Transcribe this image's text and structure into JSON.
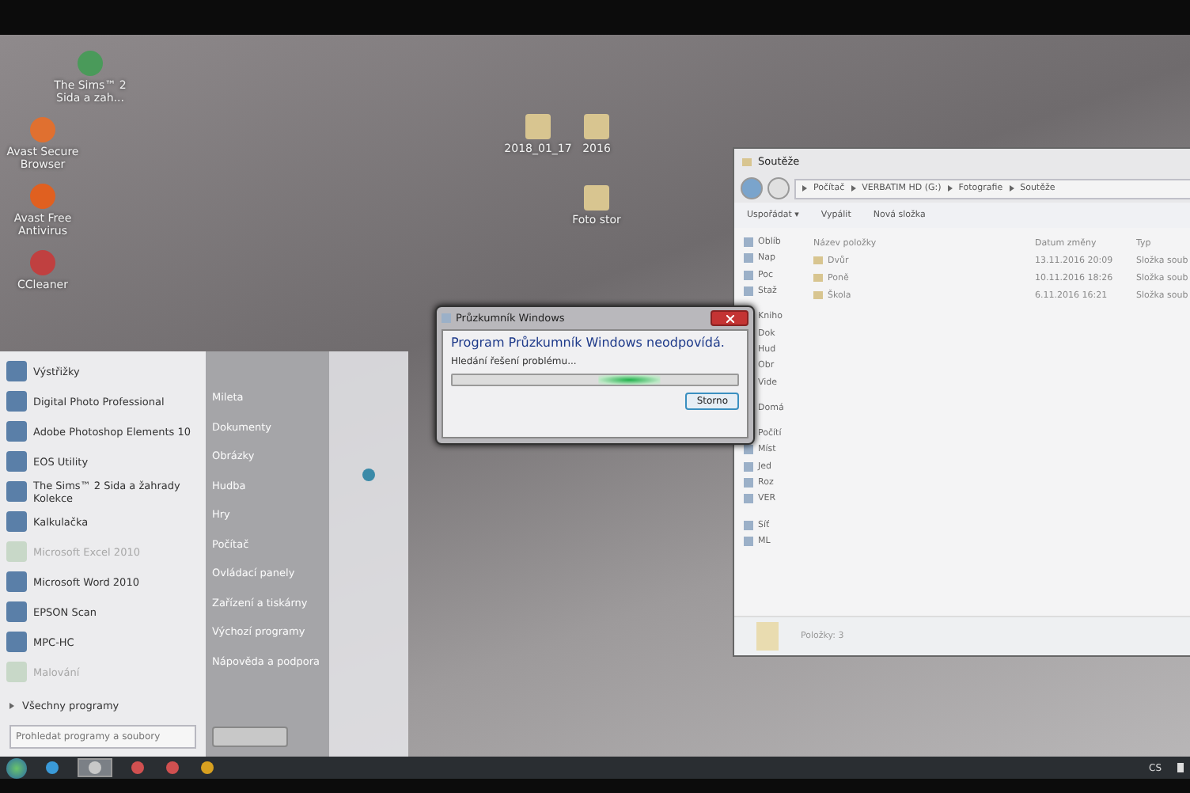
{
  "desktop_icons": [
    {
      "label": "The Sims™ 2 Sida a zah...",
      "kind": "app",
      "color": "#4a9a5a"
    },
    {
      "label": "Avast Secure Browser",
      "kind": "app",
      "color": "#e07030"
    },
    {
      "label": "Avast Free Antivirus",
      "kind": "app",
      "color": "#e06020"
    },
    {
      "label": "CCleaner",
      "kind": "app",
      "color": "#c04040"
    },
    {
      "label": "2018_01_17",
      "kind": "folder",
      "color": "#d8c590"
    },
    {
      "label": "2016",
      "kind": "folder",
      "color": "#d8c590"
    },
    {
      "label": "Foto stor",
      "kind": "folder",
      "color": "#d8c590"
    }
  ],
  "start_menu": {
    "programs": [
      {
        "label": "Výstřižky",
        "disabled": false
      },
      {
        "label": "Digital Photo Professional",
        "disabled": false
      },
      {
        "label": "Adobe Photoshop Elements 10",
        "disabled": false
      },
      {
        "label": "EOS Utility",
        "disabled": false
      },
      {
        "label": "The Sims™ 2 Sida a žahrady Kolekce",
        "disabled": false
      },
      {
        "label": "Kalkulačka",
        "disabled": false
      },
      {
        "label": "Microsoft Excel 2010",
        "disabled": true
      },
      {
        "label": "Microsoft Word 2010",
        "disabled": false
      },
      {
        "label": "EPSON Scan",
        "disabled": false
      },
      {
        "label": "MPC-HC",
        "disabled": false
      },
      {
        "label": "Malování",
        "disabled": true
      }
    ],
    "all_programs": "Všechny programy",
    "search": {
      "placeholder": "Prohledat programy a soubory"
    },
    "places": [
      "Mileta",
      "Dokumenty",
      "Obrázky",
      "Hudba",
      "Hry",
      "Počítač",
      "Ovládací panely",
      "Zařízení a tiskárny",
      "Výchozí programy",
      "Nápověda a podpora"
    ]
  },
  "dialog": {
    "title": "Průzkumník Windows",
    "heading": "Program Průzkumník Windows neodpovídá.",
    "status": "Hledání řešení problému...",
    "progress": {
      "level": 0.62
    },
    "button": "Storno"
  },
  "explorer": {
    "title": "Soutěže",
    "breadcrumb": [
      "Počítač",
      "VERBATIM HD (G:)",
      "Fotografie",
      "Soutěže"
    ],
    "toolbar": [
      "Uspořádat ▾",
      "Vypálit",
      "Nová složka"
    ],
    "nav_groups": [
      [
        "Oblíb",
        "Nap",
        "Poc",
        "Staž"
      ],
      [
        "Kniho",
        "Dok",
        "Hud",
        "Obr",
        "Vide"
      ],
      [
        "Domá"
      ],
      [
        "Počítí",
        "Míst",
        "Jed",
        "Roz",
        "VER"
      ],
      [
        "Síť",
        "ML"
      ]
    ],
    "columns": [
      "Název položky",
      "Datum změny",
      "Typ"
    ],
    "rows": [
      [
        "Dvůr",
        "13.11.2016 20:09",
        "Složka soub"
      ],
      [
        "Poně",
        "10.11.2016 18:26",
        "Složka soub"
      ],
      [
        "Škola",
        "6.11.2016 16:21",
        "Složka soub"
      ]
    ],
    "status": "Položky: 3"
  },
  "taskbar": {
    "apps": [
      {
        "kind": "ie",
        "selected": false
      },
      {
        "kind": "explorer",
        "selected": true
      },
      {
        "kind": "app",
        "selected": false
      },
      {
        "kind": "app",
        "selected": false
      },
      {
        "kind": "chrome",
        "selected": false
      }
    ],
    "language": "CS"
  }
}
